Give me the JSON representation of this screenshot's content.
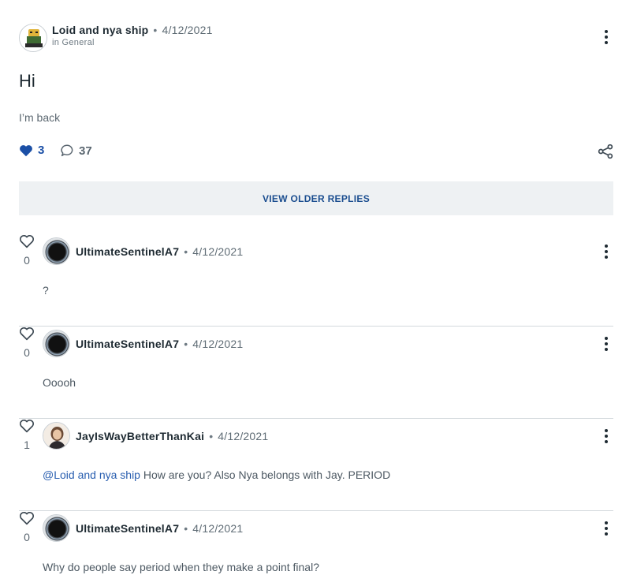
{
  "post": {
    "author": "Loid and nya ship",
    "separator": "•",
    "date": "4/12/2021",
    "category": "in General",
    "title": "Hi",
    "body": "I’m back",
    "likes": "3",
    "comments": "37"
  },
  "older_replies_label": "VIEW OLDER REPLIES",
  "replies": [
    {
      "likes": "0",
      "author": "UltimateSentinelA7",
      "date": "4/12/2021",
      "text": "?",
      "avatar": "dark-portal-avatar"
    },
    {
      "likes": "0",
      "author": "UltimateSentinelA7",
      "date": "4/12/2021",
      "text": "Ooooh",
      "avatar": "dark-portal-avatar"
    },
    {
      "likes": "1",
      "author": "JayIsWayBetterThanKai",
      "date": "4/12/2021",
      "mention": "@Loid and nya ship",
      "text": " How are you? Also Nya belongs with Jay. PERIOD",
      "avatar": "character-avatar"
    },
    {
      "likes": "0",
      "author": "UltimateSentinelA7",
      "date": "4/12/2021",
      "text": "Why do people say period when they make a point final?",
      "avatar": "dark-portal-avatar"
    }
  ],
  "colors": {
    "accent_blue": "#1b4fa6",
    "link_blue": "#2a5fb0",
    "older_bg": "#eef1f3",
    "divider": "#d4d9dd"
  },
  "icons": [
    "heart-icon",
    "comment-icon",
    "share-icon",
    "more-options-icon"
  ]
}
